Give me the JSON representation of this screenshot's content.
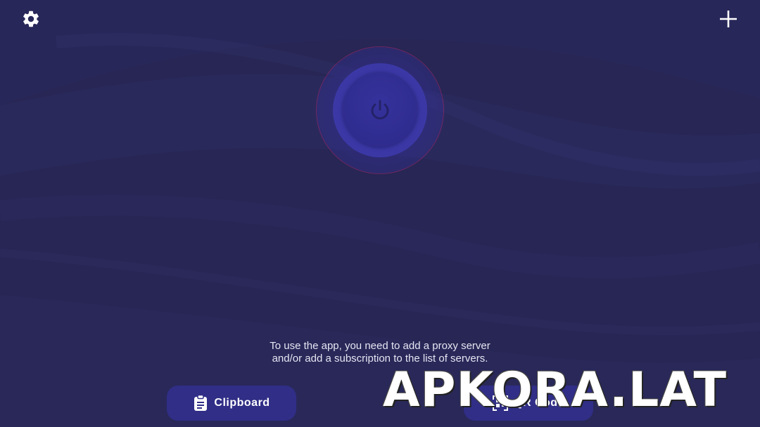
{
  "colors": {
    "background": "#272654",
    "button": "#302e86",
    "power_ring": "#3b38a6",
    "power_button": "#2f2c8f",
    "power_icon": "#232268",
    "ring_accent": "#c8286e"
  },
  "toolbar": {
    "settings_icon": "gear-icon",
    "add_icon": "plus-icon"
  },
  "power": {
    "icon": "power-icon"
  },
  "empty_state": {
    "message": "To use the app, you need to add a proxy server and/or add a subscription to the list of servers."
  },
  "actions": {
    "clipboard": {
      "label": "Clipboard",
      "icon": "clipboard-icon"
    },
    "qr_code": {
      "label": "QR Code",
      "icon": "qr-code-icon"
    }
  },
  "watermark": {
    "text": "APKORA.LAT"
  }
}
